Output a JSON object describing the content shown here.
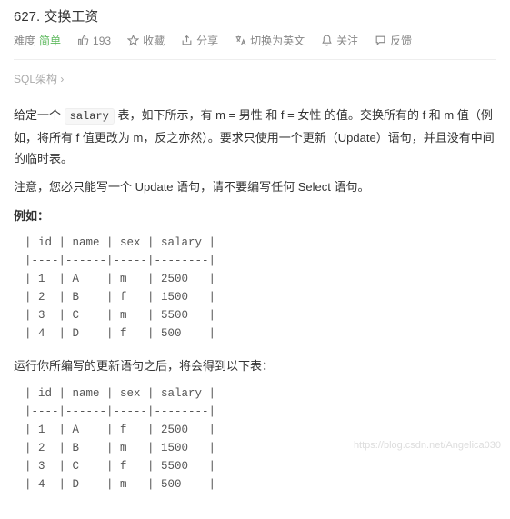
{
  "title": "627. 交换工资",
  "meta": {
    "difficulty_label": "难度",
    "difficulty_value": "简单",
    "likes_count": "193",
    "favorite": "收藏",
    "share": "分享",
    "switch_lang": "切换为英文",
    "follow": "关注",
    "feedback": "反馈"
  },
  "schema_link": "SQL架构 ›",
  "desc": {
    "p1_a": "给定一个 ",
    "p1_code": "salary",
    "p1_b": " 表，如下所示，有 m = 男性 和 f = 女性 的值。交换所有的 f 和 m 值（例如，将所有 f 值更改为 m，反之亦然）。要求只使用一个更新（Update）语句，并且没有中间的临时表。",
    "p2": "注意，您必只能写一个 Update 语句，请不要编写任何 Select 语句。",
    "example_heading": "例如：",
    "after_text": "运行你所编写的更新语句之后，将会得到以下表：",
    "table1": "| id | name | sex | salary |\n|----|------|-----|--------|\n| 1  | A    | m   | 2500   |\n| 2  | B    | f   | 1500   |\n| 3  | C    | m   | 5500   |\n| 4  | D    | f   | 500    |",
    "table2": "| id | name | sex | salary |\n|----|------|-----|--------|\n| 1  | A    | f   | 2500   |\n| 2  | B    | m   | 1500   |\n| 3  | C    | f   | 5500   |\n| 4  | D    | m   | 500    |"
  },
  "watermark": "https://blog.csdn.net/Angelica030"
}
